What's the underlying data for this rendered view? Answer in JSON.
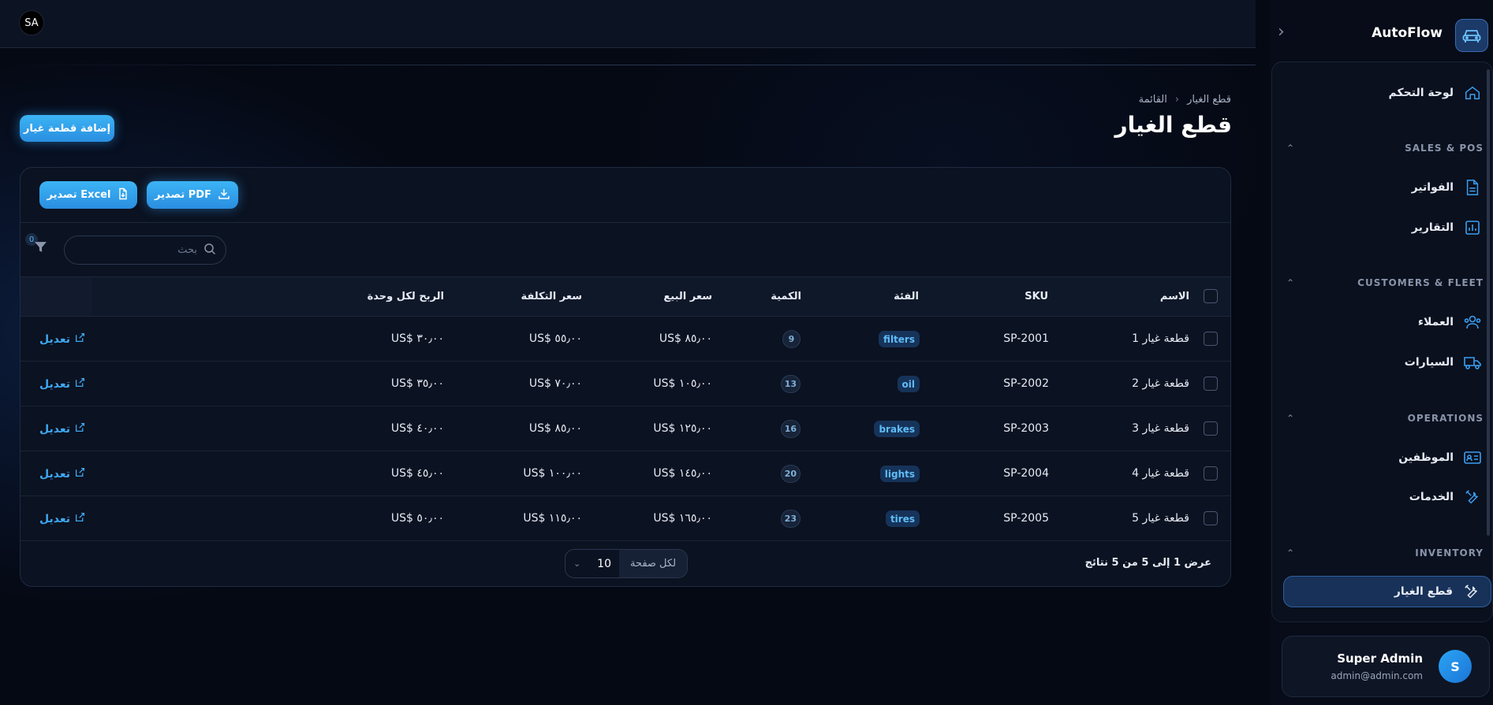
{
  "topbar": {
    "avatar": "SA"
  },
  "sidebar": {
    "brand": "AutoFlow",
    "dashboard": "لوحة التحكم",
    "sections": [
      {
        "title": "SALES & POS",
        "items": [
          "الفواتير",
          "التقارير"
        ]
      },
      {
        "title": "CUSTOMERS & FLEET",
        "items": [
          "العملاء",
          "السيارات"
        ]
      },
      {
        "title": "OPERATIONS",
        "items": [
          "الموظفين",
          "الخدمات"
        ]
      },
      {
        "title": "INVENTORY",
        "items": [
          "قطع الغيار"
        ]
      }
    ],
    "user": {
      "name": "Super Admin",
      "email": "admin@admin.com",
      "initial": "S"
    }
  },
  "page": {
    "breadcrumb": [
      "قطع الغيار",
      "القائمة"
    ],
    "title": "قطع الغيار",
    "add_button": "إضافة قطعة غيار"
  },
  "toolbar": {
    "export_pdf": "تصدير PDF",
    "export_excel": "تصدير Excel",
    "search_placeholder": "بحث",
    "filter_count": "0"
  },
  "table": {
    "columns": [
      "الاسم",
      "SKU",
      "الفئة",
      "الكمية",
      "سعر البيع",
      "سعر التكلفة",
      "الربح لكل وحدة"
    ],
    "edit_label": "تعديل",
    "rows": [
      {
        "name": "قطعة غيار 1",
        "sku": "SP-2001",
        "category": "filters",
        "qty": "9",
        "price": "US$ ٨٥٫٠٠",
        "cost": "US$ ٥٥٫٠٠",
        "profit": "US$ ٣٠٫٠٠"
      },
      {
        "name": "قطعة غيار 2",
        "sku": "SP-2002",
        "category": "oil",
        "qty": "13",
        "price": "US$ ١٠٥٫٠٠",
        "cost": "US$ ٧٠٫٠٠",
        "profit": "US$ ٣٥٫٠٠"
      },
      {
        "name": "قطعة غيار 3",
        "sku": "SP-2003",
        "category": "brakes",
        "qty": "16",
        "price": "US$ ١٢٥٫٠٠",
        "cost": "US$ ٨٥٫٠٠",
        "profit": "US$ ٤٠٫٠٠"
      },
      {
        "name": "قطعة غيار 4",
        "sku": "SP-2004",
        "category": "lights",
        "qty": "20",
        "price": "US$ ١٤٥٫٠٠",
        "cost": "US$ ١٠٠٫٠٠",
        "profit": "US$ ٤٥٫٠٠"
      },
      {
        "name": "قطعة غيار 5",
        "sku": "SP-2005",
        "category": "tires",
        "qty": "23",
        "price": "US$ ١٦٥٫٠٠",
        "cost": "US$ ١١٥٫٠٠",
        "profit": "US$ ٥٠٫٠٠"
      }
    ]
  },
  "footer": {
    "count_text": "عرض 1 إلى 5 من 5 نتائج",
    "per_page_label": "لكل صفحة",
    "per_page_value": "10"
  }
}
